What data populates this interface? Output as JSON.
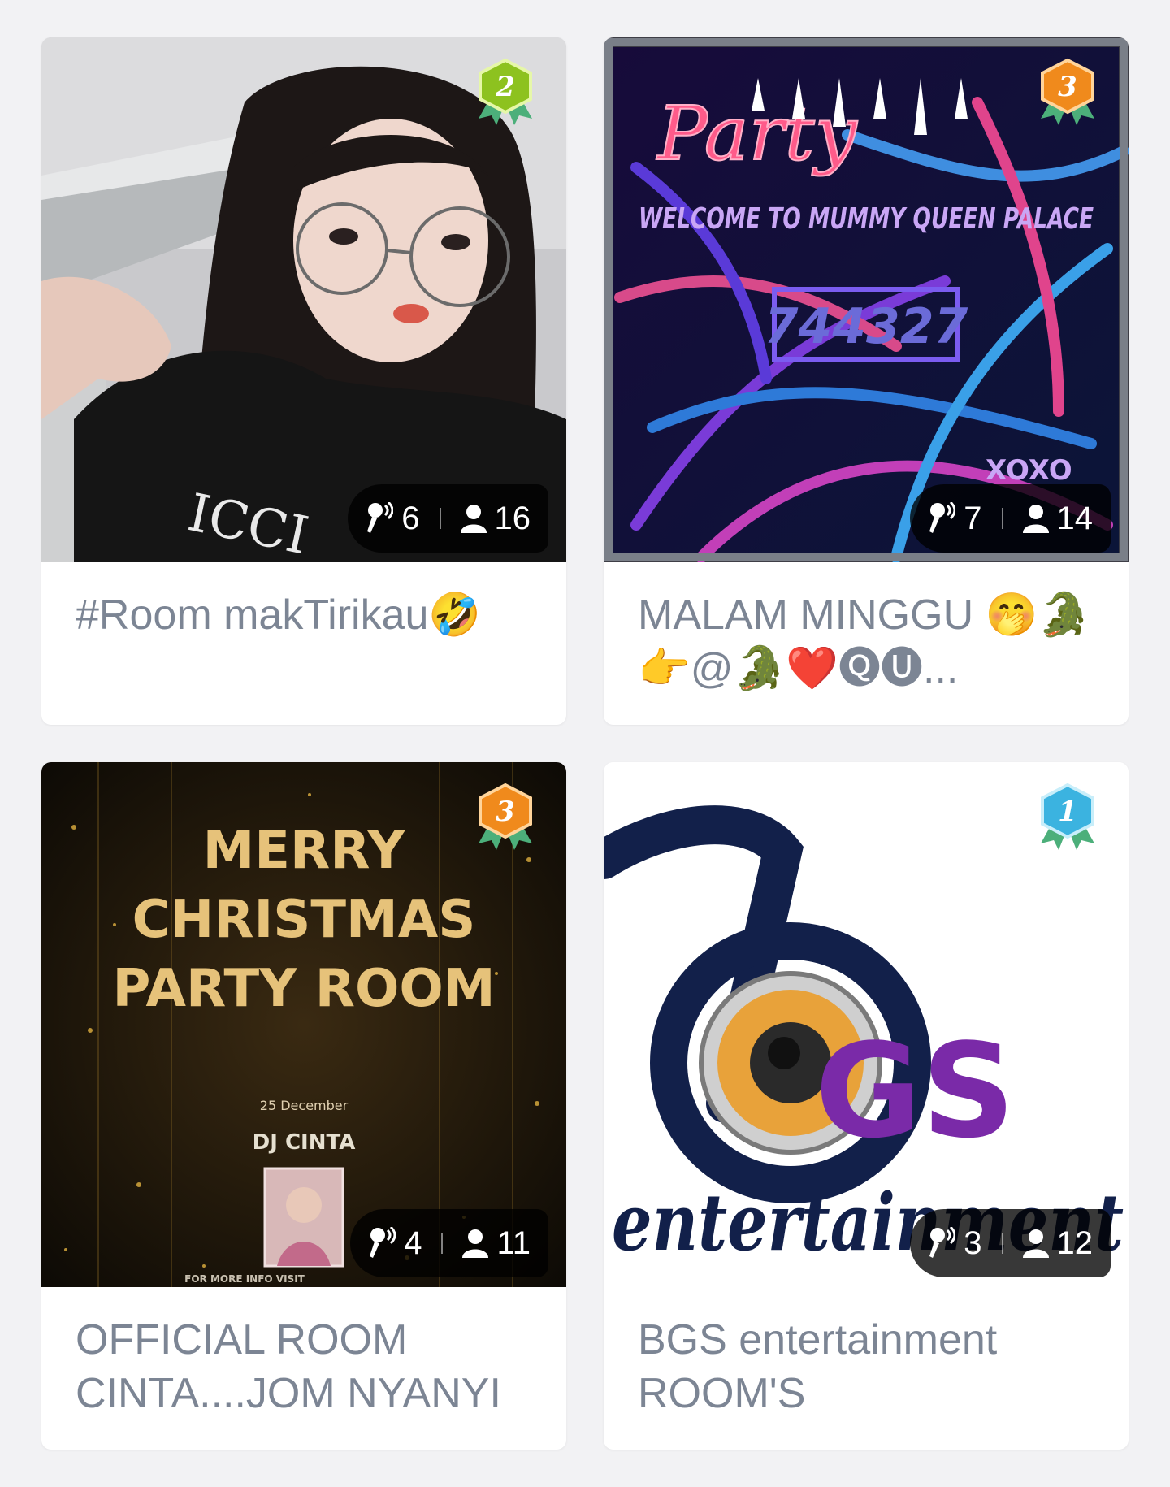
{
  "rooms": [
    {
      "title": "#Room makTirikau🤣",
      "rank": "2",
      "rank_color": "#8dc21f",
      "singers": "6",
      "listeners": "16"
    },
    {
      "title": "MALAM MINGGU 🤭🐊👉@🐊❤️🅠🅤...",
      "rank": "3",
      "rank_color": "#f08a1c",
      "singers": "7",
      "listeners": "14",
      "cover_text": {
        "party": "Party",
        "welcome": "WELCOME TO MUMMY QUEEN PALACE",
        "code": "744327",
        "xoxo": "XOXO"
      }
    },
    {
      "title": "OFFICIAL ROOM CINTA....JOM NYANYI",
      "rank": "3",
      "rank_color": "#f08a1c",
      "singers": "4",
      "listeners": "11",
      "cover_text": {
        "line1": "MERRY",
        "line2": "CHRISTMAS",
        "line3": "PARTY ROOM",
        "date": "25 December",
        "dj": "DJ CINTA",
        "footer": "FOR MORE INFO VISIT"
      }
    },
    {
      "title": "BGS entertainment ROOM'S",
      "rank": "1",
      "rank_color": "#3bb3e0",
      "singers": "3",
      "listeners": "12",
      "cover_text": {
        "gs": "GS",
        "entertainment": "entertainment"
      }
    }
  ],
  "icons": {
    "singers": "microphone-icon",
    "listeners": "person-icon",
    "rank": "rank-medal-icon"
  }
}
